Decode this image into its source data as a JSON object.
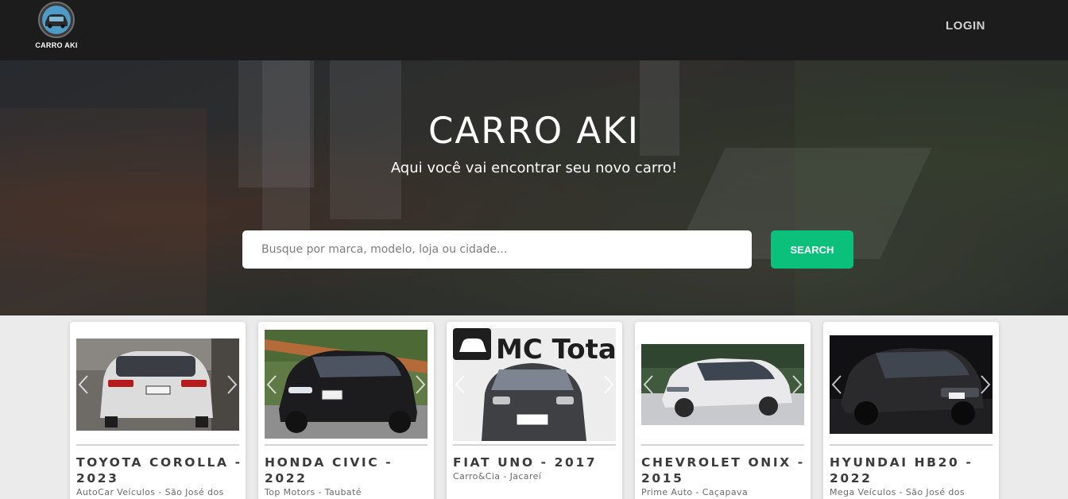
{
  "header": {
    "brand": "CARRO AKI",
    "login_label": "LOGIN"
  },
  "hero": {
    "title": "CARRO AKI",
    "subtitle": "Aqui você vai encontrar seu novo carro!",
    "search_placeholder": "Busque por marca, modelo, loja ou cidade...",
    "search_button": "SEARCH"
  },
  "cards": [
    {
      "title": "TOYOTA COROLLA - 2023",
      "store": "AutoCar Veículos - São José dos",
      "color": "#dcdcdc"
    },
    {
      "title": "HONDA CIVIC - 2022",
      "store": "Top Motors - Taubaté",
      "color": "#1c1c1e"
    },
    {
      "title": "FIAT UNO - 2017",
      "store": "Carro&Cia - Jacareí",
      "color": "#3e4044"
    },
    {
      "title": "CHEVROLET ONIX - 2015",
      "store": "Prime Auto - Caçapava",
      "color": "#e9e9eb"
    },
    {
      "title": "HYUNDAI HB20 - 2022",
      "store": "Mega Veículos - São José dos",
      "color": "#2a2a2c"
    }
  ],
  "icons": {
    "logo": "car-logo-icon",
    "prev": "chevron-left-icon",
    "next": "chevron-right-icon"
  },
  "colors": {
    "header_bg": "#1c1c1c",
    "accent": "#0bc07a",
    "page_bg": "#ebebeb"
  },
  "photo_text": {
    "fiat_dealer_banner": "MC Total veiculo"
  }
}
